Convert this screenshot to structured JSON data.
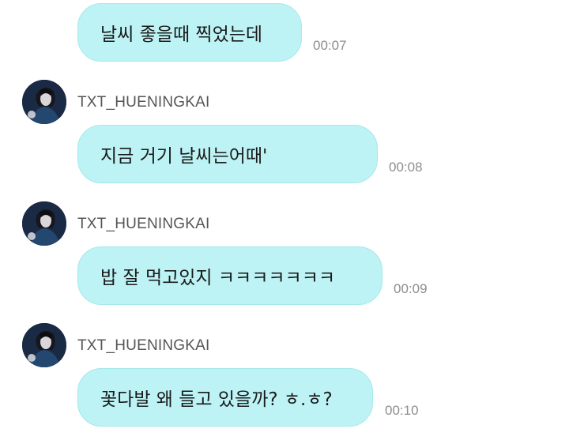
{
  "messages": [
    {
      "sender": "",
      "text": "날씨 좋을때 찍었는데",
      "time": "00:07"
    },
    {
      "sender": "TXT_HUENINGKAI",
      "text": "지금 거기 날씨는어때'",
      "time": "00:08"
    },
    {
      "sender": "TXT_HUENINGKAI",
      "text": "밥 잘 먹고있지 ㅋㅋㅋㅋㅋㅋㅋ",
      "time": "00:09"
    },
    {
      "sender": "TXT_HUENINGKAI",
      "text": "꽃다발 왜 들고 있을까? ㅎ.ㅎ?",
      "time": "00:10"
    }
  ],
  "colors": {
    "bubble": "#bdf3f5",
    "bubble_border": "#a6e8ea",
    "time": "#8d8d8d",
    "sender": "#555555"
  },
  "icons": {
    "avatar": "profile-photo"
  }
}
